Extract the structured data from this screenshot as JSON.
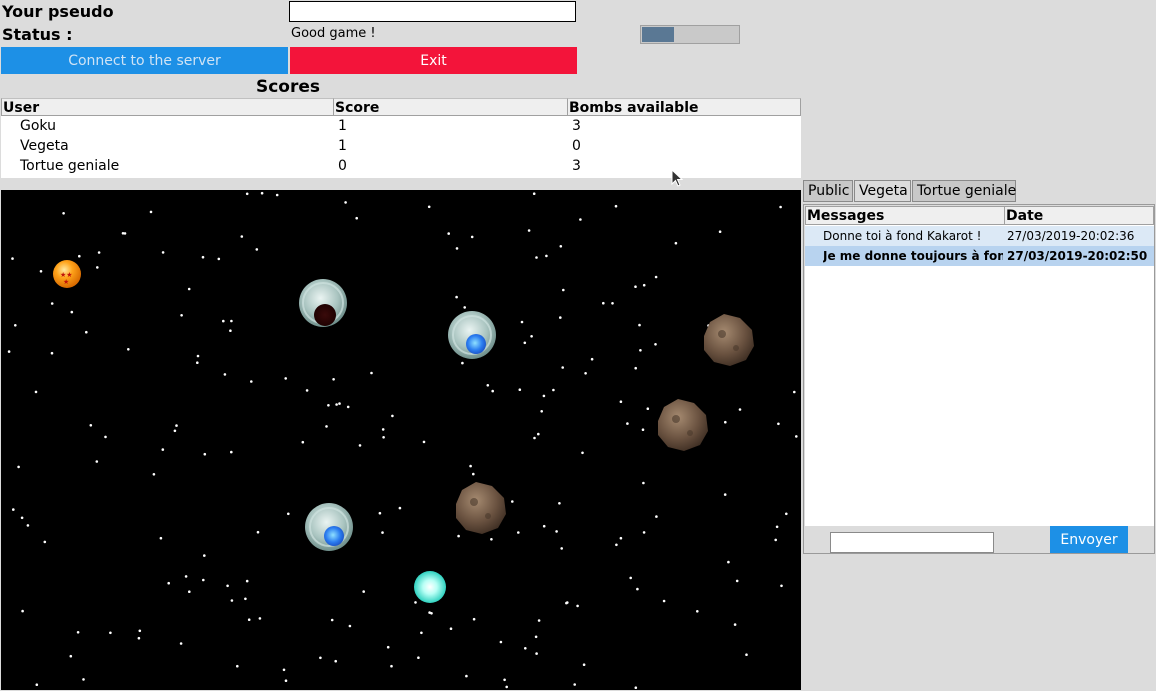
{
  "header": {
    "pseudo_label": "Your pseudo",
    "pseudo_value": "",
    "status_label": "Status :",
    "status_text": "Good game !",
    "progress_fraction": 0.33
  },
  "buttons": {
    "connect_label": "Connect to the server",
    "exit_label": "Exit",
    "connect_color": "#1d90e6",
    "exit_color": "#f3143a"
  },
  "scores": {
    "title": "Scores",
    "columns": [
      "User",
      "Score",
      "Bombs available"
    ],
    "rows": [
      {
        "user": "Goku",
        "score": "1",
        "bombs": "3"
      },
      {
        "user": "Vegeta",
        "score": "1",
        "bombs": "0"
      },
      {
        "user": "Tortue geniale",
        "score": "0",
        "bombs": "3"
      }
    ]
  },
  "game": {
    "background_color": "#000000",
    "objects": [
      "dragon-ball-icon",
      "player-ship-icon",
      "player-ship-icon",
      "player-ship-icon",
      "asteroid-icon",
      "asteroid-icon",
      "asteroid-icon",
      "energy-ball-icon"
    ]
  },
  "chat": {
    "tabs": [
      "Public",
      "Vegeta",
      "Tortue geniale"
    ],
    "active_tab": "Vegeta",
    "columns": [
      "Messages",
      "Date"
    ],
    "messages": [
      {
        "text": "Donne toi à fond Kakarot !",
        "date": "27/03/2019-20:02:36"
      },
      {
        "text": "Je me donne toujours à fond",
        "date": "27/03/2019-20:02:50"
      }
    ],
    "input_value": "",
    "send_label": "Envoyer"
  }
}
